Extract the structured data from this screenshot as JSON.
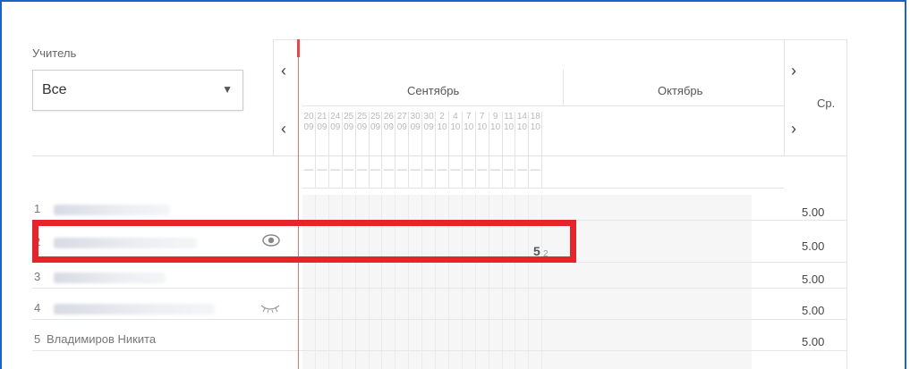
{
  "filter": {
    "label": "Учитель",
    "value": "Все"
  },
  "header": {
    "prev_icon": "chevron-left-icon",
    "next_icon": "chevron-right-icon",
    "months": [
      "Сентябрь",
      "Октябрь"
    ],
    "average_label": "Ср.",
    "days": [
      {
        "d": "20",
        "m": "09"
      },
      {
        "d": "21",
        "m": "09"
      },
      {
        "d": "24",
        "m": "09"
      },
      {
        "d": "25",
        "m": "09"
      },
      {
        "d": "25",
        "m": "09"
      },
      {
        "d": "25",
        "m": "09"
      },
      {
        "d": "26",
        "m": "09"
      },
      {
        "d": "27",
        "m": "09"
      },
      {
        "d": "30",
        "m": "09"
      },
      {
        "d": "30",
        "m": "09"
      },
      {
        "d": "2",
        "m": "10"
      },
      {
        "d": "4",
        "m": "10"
      },
      {
        "d": "7",
        "m": "10"
      },
      {
        "d": "7",
        "m": "10"
      },
      {
        "d": "9",
        "m": "10"
      },
      {
        "d": "11",
        "m": "10"
      },
      {
        "d": "14",
        "m": "10"
      },
      {
        "d": "18",
        "m": "10"
      }
    ],
    "dash": "—"
  },
  "students": [
    {
      "num": "1",
      "name": "",
      "avg": "5.00",
      "icon": ""
    },
    {
      "num": "2",
      "name": "",
      "avg": "5.00",
      "icon": "eye-icon",
      "grade": "5",
      "grade_sub": "2"
    },
    {
      "num": "3",
      "name": "",
      "avg": "5.00",
      "icon": ""
    },
    {
      "num": "4",
      "name": "",
      "avg": "5.00",
      "icon": "closed-eye-icon"
    },
    {
      "num": "5",
      "name": "Владимиров Никита",
      "avg": "5.00",
      "icon": ""
    }
  ]
}
